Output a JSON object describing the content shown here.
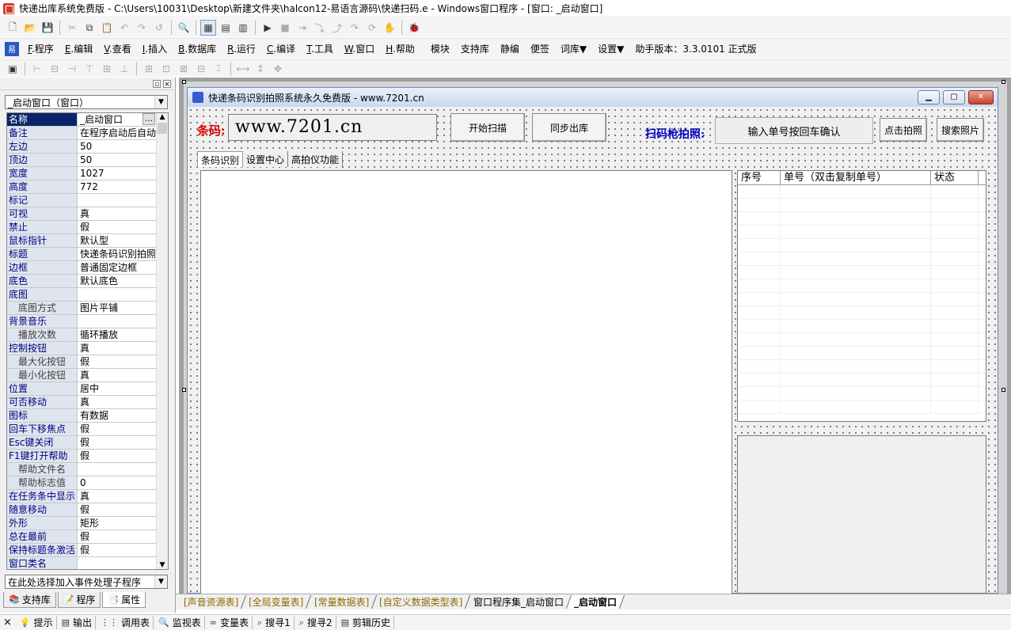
{
  "app": {
    "title": "快递出库系统免费版 - C:\\Users\\10031\\Desktop\\新建文件夹\\halcon12-易语言源码\\快递扫码.e - Windows窗口程序 - [窗口: _启动窗口]"
  },
  "toolbar1": {
    "icons": [
      "new-file-icon",
      "open-icon",
      "save-icon",
      "cut-icon",
      "copy-icon",
      "paste-icon",
      "undo-icon",
      "redo-icon",
      "redo2-icon",
      "find-icon",
      "layout1-icon",
      "layout2-icon",
      "layout3-icon",
      "run-icon",
      "stop-icon",
      "step-icon",
      "step-into-icon",
      "step-out-icon",
      "step-over-icon",
      "step-run-icon",
      "hand-icon",
      "debug-icon"
    ]
  },
  "menubar": {
    "items": [
      {
        "key": "F",
        "label": ".程序"
      },
      {
        "key": "E",
        "label": ".编辑"
      },
      {
        "key": "V",
        "label": ".查看"
      },
      {
        "key": "I",
        "label": ".插入"
      },
      {
        "key": "B",
        "label": ".数据库"
      },
      {
        "key": "R",
        "label": ".运行"
      },
      {
        "key": "C",
        "label": ".编译"
      },
      {
        "key": "T",
        "label": ".工具"
      },
      {
        "key": "W",
        "label": ".窗口"
      },
      {
        "key": "H",
        "label": ".帮助"
      }
    ],
    "extra": [
      "模块",
      "支持库",
      "静编",
      "便签",
      "词库▼",
      "设置▼",
      "助手版本：3.3.0101 正式版"
    ]
  },
  "left_panel": {
    "object_combo": "_启动窗口（窗口）",
    "properties": [
      {
        "name": "名称",
        "value": "_启动窗口",
        "selected": true,
        "has_button": true
      },
      {
        "name": "备注",
        "value": "在程序启动后自动"
      },
      {
        "name": "左边",
        "value": "50"
      },
      {
        "name": "顶边",
        "value": "50"
      },
      {
        "name": "宽度",
        "value": "1027"
      },
      {
        "name": "高度",
        "value": "772"
      },
      {
        "name": "标记",
        "value": ""
      },
      {
        "name": "可视",
        "value": "真"
      },
      {
        "name": "禁止",
        "value": "假"
      },
      {
        "name": "鼠标指针",
        "value": "默认型"
      },
      {
        "name": "标题",
        "value": "快递条码识别拍照"
      },
      {
        "name": "边框",
        "value": "普通固定边框"
      },
      {
        "name": "底色",
        "value": "默认底色"
      },
      {
        "name": "底图",
        "value": ""
      },
      {
        "name": "底图方式",
        "value": "图片平铺",
        "sub": true
      },
      {
        "name": "背景音乐",
        "value": ""
      },
      {
        "name": "播放次数",
        "value": "循环播放",
        "sub": true
      },
      {
        "name": "控制按钮",
        "value": "真"
      },
      {
        "name": "最大化按钮",
        "value": "假",
        "sub": true
      },
      {
        "name": "最小化按钮",
        "value": "真",
        "sub": true
      },
      {
        "name": "位置",
        "value": "居中"
      },
      {
        "name": "可否移动",
        "value": "真"
      },
      {
        "name": "图标",
        "value": "有数据"
      },
      {
        "name": "回车下移焦点",
        "value": "假"
      },
      {
        "name": "Esc键关闭",
        "value": "假"
      },
      {
        "name": "F1键打开帮助",
        "value": "假"
      },
      {
        "name": "帮助文件名",
        "value": "",
        "sub": true
      },
      {
        "name": "帮助标志值",
        "value": "0",
        "sub": true
      },
      {
        "name": "在任务条中显示",
        "value": "真"
      },
      {
        "name": "随意移动",
        "value": "假"
      },
      {
        "name": "外形",
        "value": "矩形"
      },
      {
        "name": "总在最前",
        "value": "假"
      },
      {
        "name": "保持标题条激活",
        "value": "假"
      },
      {
        "name": "窗口类名",
        "value": ""
      }
    ],
    "event_combo": "在此处选择加入事件处理子程序",
    "tabs": [
      {
        "label": "支持库",
        "icon": "library-icon"
      },
      {
        "label": "程序",
        "icon": "program-icon"
      },
      {
        "label": "属性",
        "icon": "property-icon",
        "active": true
      }
    ]
  },
  "form": {
    "title": "快递条码识别拍照系统永久免费版  -  www.7201.cn",
    "barcode_label": "条码:",
    "barcode_value": "www.7201.cn",
    "btn_start_scan": "开始扫描",
    "btn_sync_out": "同步出库",
    "scan_label": "扫码枪拍照:",
    "scan_input": "输入单号按回车确认",
    "btn_photo": "点击拍照",
    "btn_search_photo": "搜索照片",
    "tabs": [
      "条码识别",
      "设置中心",
      "高拍仪功能"
    ],
    "list_headers": [
      "序号",
      "单号（双击复制单号）",
      "状态"
    ]
  },
  "editor_tabs": [
    {
      "label": "[声音资源表]",
      "type": "res"
    },
    {
      "label": "[全局变量表]",
      "type": "res"
    },
    {
      "label": "[常量数据表]",
      "type": "res"
    },
    {
      "label": "[自定义数据类型表]",
      "type": "res"
    },
    {
      "label": "窗口程序集_启动窗口",
      "type": "normal"
    },
    {
      "label": "_启动窗口",
      "type": "active"
    }
  ],
  "statusbar": {
    "items": [
      {
        "label": "提示",
        "icon": "hint-icon"
      },
      {
        "label": "输出",
        "icon": "output-icon"
      },
      {
        "label": "调用表",
        "icon": "callstack-icon"
      },
      {
        "label": "监视表",
        "icon": "watch-icon"
      },
      {
        "label": "变量表",
        "icon": "variables-icon"
      },
      {
        "label": "搜寻1",
        "icon": "search1-icon"
      },
      {
        "label": "搜寻2",
        "icon": "search2-icon"
      },
      {
        "label": "剪辑历史",
        "icon": "clip-history-icon"
      }
    ]
  }
}
